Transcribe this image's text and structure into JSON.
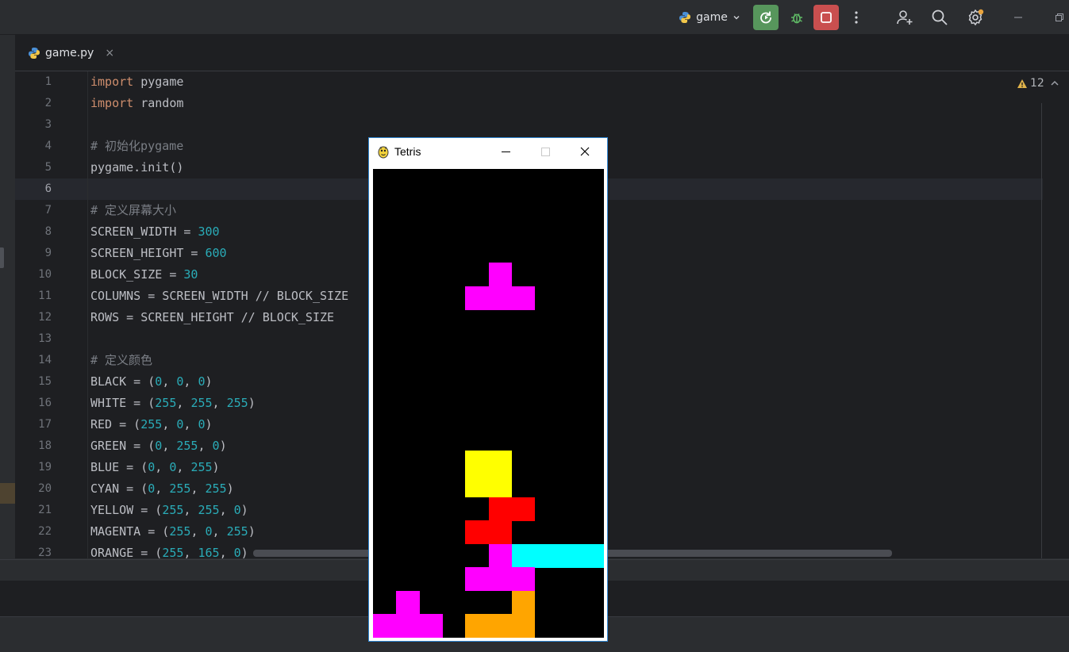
{
  "ide": {
    "run_config": {
      "name": "game"
    },
    "toolbar_icons": [
      "python-icon",
      "chevron-down-icon",
      "rerun-icon",
      "debug-icon",
      "stop-icon",
      "more-icon",
      "add-user-icon",
      "search-icon",
      "settings-icon",
      "minimize-icon",
      "restore-icon"
    ],
    "tab": {
      "label": "game.py",
      "close": "×"
    },
    "inspection": {
      "warning_count": "12"
    },
    "current_line": 6
  },
  "code_lines": [
    {
      "n": "1",
      "t": [
        [
          "kw",
          "import"
        ],
        [
          "",
          "  pygame"
        ]
      ]
    },
    {
      "n": "2",
      "t": [
        [
          "kw",
          "import"
        ],
        [
          "",
          "  random"
        ]
      ]
    },
    {
      "n": "3",
      "t": []
    },
    {
      "n": "4",
      "t": [
        [
          "cmt",
          "# 初始化pygame"
        ]
      ]
    },
    {
      "n": "5",
      "t": [
        [
          "",
          "pygame.init()"
        ]
      ]
    },
    {
      "n": "6",
      "t": []
    },
    {
      "n": "7",
      "t": [
        [
          "cmt",
          "# 定义屏幕大小"
        ]
      ]
    },
    {
      "n": "8",
      "t": [
        [
          "",
          "SCREEN_WIDTH = "
        ],
        [
          "num",
          "300"
        ]
      ]
    },
    {
      "n": "9",
      "t": [
        [
          "",
          "SCREEN_HEIGHT = "
        ],
        [
          "num",
          "600"
        ]
      ]
    },
    {
      "n": "10",
      "t": [
        [
          "",
          "BLOCK_SIZE = "
        ],
        [
          "num",
          "30"
        ]
      ]
    },
    {
      "n": "11",
      "t": [
        [
          "",
          "COLUMNS = SCREEN_WIDTH // BLOCK_SIZE"
        ]
      ]
    },
    {
      "n": "12",
      "t": [
        [
          "",
          "ROWS = SCREEN_HEIGHT // BLOCK_SIZE"
        ]
      ]
    },
    {
      "n": "13",
      "t": []
    },
    {
      "n": "14",
      "t": [
        [
          "cmt",
          "# 定义颜色"
        ]
      ]
    },
    {
      "n": "15",
      "t": [
        [
          "",
          "BLACK = ("
        ],
        [
          "num",
          "0"
        ],
        [
          "",
          ", "
        ],
        [
          "num",
          "0"
        ],
        [
          "",
          ", "
        ],
        [
          "num",
          "0"
        ],
        [
          "",
          ")"
        ]
      ]
    },
    {
      "n": "16",
      "t": [
        [
          "",
          "WHITE = ("
        ],
        [
          "num",
          "255"
        ],
        [
          "",
          ", "
        ],
        [
          "num",
          "255"
        ],
        [
          "",
          ", "
        ],
        [
          "num",
          "255"
        ],
        [
          "",
          ")"
        ]
      ]
    },
    {
      "n": "17",
      "t": [
        [
          "",
          "RED = ("
        ],
        [
          "num",
          "255"
        ],
        [
          "",
          ", "
        ],
        [
          "num",
          "0"
        ],
        [
          "",
          ", "
        ],
        [
          "num",
          "0"
        ],
        [
          "",
          ")"
        ]
      ]
    },
    {
      "n": "18",
      "t": [
        [
          "",
          "GREEN = ("
        ],
        [
          "num",
          "0"
        ],
        [
          "",
          ", "
        ],
        [
          "num",
          "255"
        ],
        [
          "",
          ", "
        ],
        [
          "num",
          "0"
        ],
        [
          "",
          ")"
        ]
      ]
    },
    {
      "n": "19",
      "t": [
        [
          "",
          "BLUE = ("
        ],
        [
          "num",
          "0"
        ],
        [
          "",
          ", "
        ],
        [
          "num",
          "0"
        ],
        [
          "",
          ", "
        ],
        [
          "num",
          "255"
        ],
        [
          "",
          ")"
        ]
      ]
    },
    {
      "n": "20",
      "t": [
        [
          "",
          "CYAN = ("
        ],
        [
          "num",
          "0"
        ],
        [
          "",
          ", "
        ],
        [
          "num",
          "255"
        ],
        [
          "",
          ", "
        ],
        [
          "num",
          "255"
        ],
        [
          "",
          ")"
        ]
      ]
    },
    {
      "n": "21",
      "t": [
        [
          "",
          "YELLOW = ("
        ],
        [
          "num",
          "255"
        ],
        [
          "",
          ", "
        ],
        [
          "num",
          "255"
        ],
        [
          "",
          ", "
        ],
        [
          "num",
          "0"
        ],
        [
          "",
          ")"
        ]
      ]
    },
    {
      "n": "22",
      "t": [
        [
          "",
          "MAGENTA = ("
        ],
        [
          "num",
          "255"
        ],
        [
          "",
          ", "
        ],
        [
          "num",
          "0"
        ],
        [
          "",
          ", "
        ],
        [
          "num",
          "255"
        ],
        [
          "",
          ")"
        ]
      ]
    },
    {
      "n": "23",
      "t": [
        [
          "",
          "ORANGE = ("
        ],
        [
          "num",
          "255"
        ],
        [
          "",
          ", "
        ],
        [
          "num",
          "165"
        ],
        [
          "",
          ", "
        ],
        [
          "num",
          "0"
        ],
        [
          "",
          ")"
        ]
      ]
    }
  ],
  "tetris": {
    "window_title": "Tetris",
    "controls": {
      "minimize": "—",
      "maximize": "☐",
      "close": "✕"
    },
    "grid": {
      "columns": 10,
      "rows": 20
    },
    "colors": {
      "magenta": "#ff00ff",
      "yellow": "#ffff00",
      "red": "#ff0000",
      "cyan": "#00ffff",
      "orange": "#ffa500"
    },
    "blocks": [
      {
        "c": 5,
        "r": 4,
        "color": "magenta"
      },
      {
        "c": 4,
        "r": 5,
        "color": "magenta"
      },
      {
        "c": 5,
        "r": 5,
        "color": "magenta"
      },
      {
        "c": 6,
        "r": 5,
        "color": "magenta"
      },
      {
        "c": 4,
        "r": 12,
        "color": "yellow"
      },
      {
        "c": 5,
        "r": 12,
        "color": "yellow"
      },
      {
        "c": 4,
        "r": 13,
        "color": "yellow"
      },
      {
        "c": 5,
        "r": 13,
        "color": "yellow"
      },
      {
        "c": 5,
        "r": 14,
        "color": "red"
      },
      {
        "c": 6,
        "r": 14,
        "color": "red"
      },
      {
        "c": 4,
        "r": 15,
        "color": "red"
      },
      {
        "c": 5,
        "r": 15,
        "color": "red"
      },
      {
        "c": 5,
        "r": 16,
        "color": "magenta"
      },
      {
        "c": 6,
        "r": 16,
        "color": "cyan"
      },
      {
        "c": 7,
        "r": 16,
        "color": "cyan"
      },
      {
        "c": 8,
        "r": 16,
        "color": "cyan"
      },
      {
        "c": 9,
        "r": 16,
        "color": "cyan"
      },
      {
        "c": 4,
        "r": 17,
        "color": "magenta"
      },
      {
        "c": 5,
        "r": 17,
        "color": "magenta"
      },
      {
        "c": 6,
        "r": 17,
        "color": "magenta"
      },
      {
        "c": 1,
        "r": 18,
        "color": "magenta"
      },
      {
        "c": 6,
        "r": 18,
        "color": "orange"
      },
      {
        "c": 0,
        "r": 19,
        "color": "magenta"
      },
      {
        "c": 1,
        "r": 19,
        "color": "magenta"
      },
      {
        "c": 2,
        "r": 19,
        "color": "magenta"
      },
      {
        "c": 4,
        "r": 19,
        "color": "orange"
      },
      {
        "c": 5,
        "r": 19,
        "color": "orange"
      },
      {
        "c": 6,
        "r": 19,
        "color": "orange"
      }
    ]
  }
}
